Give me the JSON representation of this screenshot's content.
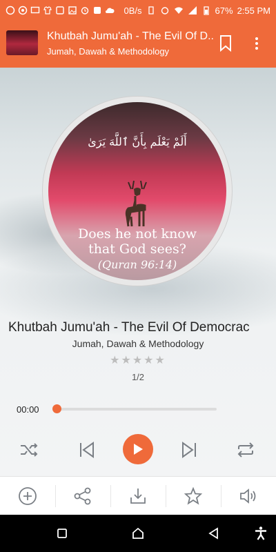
{
  "status_bar": {
    "network_speed": "0B/s",
    "battery": "67%",
    "time": "2:55 PM"
  },
  "app_bar": {
    "title": "Khutbah Jumu'ah - The Evil Of D..",
    "subtitle": "Jumah, Dawah & Methodology"
  },
  "artwork": {
    "arabic_text": "أَلَمْ يَعْلَم بِأَنَّ ٱللَّهَ يَرَىٰ",
    "quote_line1": "Does he not know",
    "quote_line2": "that God sees?",
    "reference": "(Quran 96:14)"
  },
  "track": {
    "title": "Khutbah Jumu'ah - The Evil Of Democrac",
    "subtitle": "Jumah, Dawah & Methodology",
    "rating": 0,
    "rating_max": 5,
    "stars_text": "★★★★★",
    "position": "1/2"
  },
  "player": {
    "elapsed": "00:00",
    "progress": 0.0
  },
  "colors": {
    "accent": "#ef6a3a",
    "icon_gray": "#7a7f85"
  }
}
